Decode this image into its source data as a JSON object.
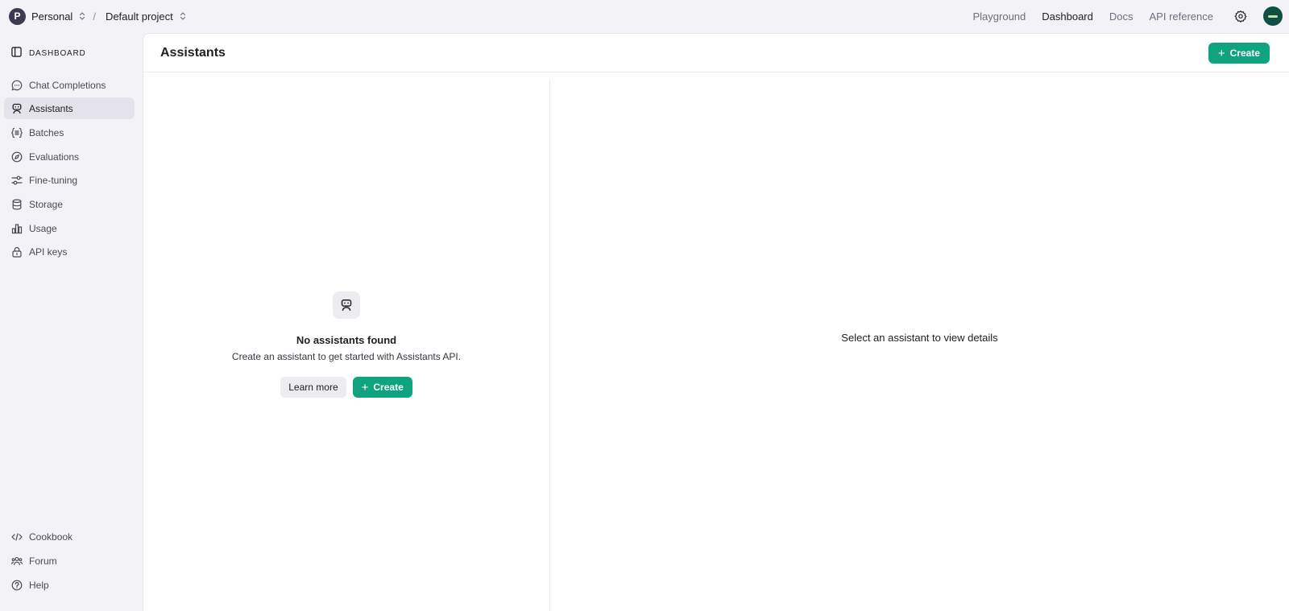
{
  "topbar": {
    "org": {
      "initial": "P",
      "name": "Personal"
    },
    "separator": "/",
    "project": "Default project",
    "links": [
      {
        "label": "Playground",
        "active": false
      },
      {
        "label": "Dashboard",
        "active": true
      },
      {
        "label": "Docs",
        "active": false
      },
      {
        "label": "API reference",
        "active": false
      }
    ],
    "settings_icon": "gear-icon",
    "user_avatar_icon": "user-avatar"
  },
  "sidebar": {
    "header": "DASHBOARD",
    "items": [
      {
        "label": "Chat Completions",
        "icon": "chat-bubble-icon"
      },
      {
        "label": "Assistants",
        "icon": "robot-icon",
        "active": true
      },
      {
        "label": "Batches",
        "icon": "batch-list-icon"
      },
      {
        "label": "Evaluations",
        "icon": "compass-icon"
      },
      {
        "label": "Fine-tuning",
        "icon": "sliders-icon"
      },
      {
        "label": "Storage",
        "icon": "database-icon"
      },
      {
        "label": "Usage",
        "icon": "bar-chart-icon"
      },
      {
        "label": "API keys",
        "icon": "lock-icon"
      }
    ],
    "footer": [
      {
        "label": "Cookbook",
        "icon": "code-icon"
      },
      {
        "label": "Forum",
        "icon": "people-icon"
      },
      {
        "label": "Help",
        "icon": "question-icon"
      }
    ]
  },
  "main": {
    "title": "Assistants",
    "create_label": "Create",
    "empty_state": {
      "title": "No assistants found",
      "description": "Create an assistant to get started with Assistants API.",
      "learn_more_label": "Learn more",
      "create_label": "Create"
    },
    "detail_placeholder": "Select an assistant to view details"
  },
  "colors": {
    "accent": "#10a37f",
    "sidebar_bg": "#f3f2f6",
    "active_item_bg": "#e4e3ec"
  }
}
